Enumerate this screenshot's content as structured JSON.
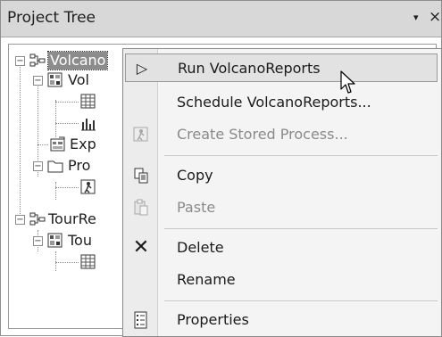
{
  "panel": {
    "title": "Project Tree",
    "pin_glyph": "▾",
    "close_glyph": "×"
  },
  "tree": {
    "nodes": [
      {
        "label": "VolcanoReports",
        "shown": "Volcano",
        "selected": true,
        "icon": "process-flow-icon"
      },
      {
        "label": "Vol",
        "icon": "program-icon"
      },
      {
        "label": "",
        "icon": "table-icon"
      },
      {
        "label": "",
        "icon": "chart-icon"
      },
      {
        "label": "Exp",
        "icon": "export-icon"
      },
      {
        "label": "Pro",
        "icon": "folder-icon"
      },
      {
        "label": "",
        "icon": "task-icon"
      },
      {
        "label": "TourRe",
        "icon": "process-flow-icon"
      },
      {
        "label": "Tou",
        "icon": "program-icon"
      },
      {
        "label": "",
        "icon": "table-icon"
      }
    ]
  },
  "context_menu": {
    "items": [
      {
        "label": "Run VolcanoReports",
        "icon": "run-icon",
        "glyph": "▷",
        "enabled": true,
        "highlighted": true
      },
      {
        "label": "Schedule VolcanoReports...",
        "icon": "",
        "glyph": "",
        "enabled": true
      },
      {
        "label": "Create Stored Process...",
        "icon": "stored-process-icon",
        "glyph": "",
        "enabled": false
      },
      {
        "label": "Copy",
        "icon": "copy-icon",
        "glyph": "",
        "enabled": true
      },
      {
        "label": "Paste",
        "icon": "paste-icon",
        "glyph": "",
        "enabled": false
      },
      {
        "label": "Delete",
        "icon": "delete-icon",
        "glyph": "✕",
        "enabled": true
      },
      {
        "label": "Rename",
        "icon": "",
        "glyph": "",
        "enabled": true
      },
      {
        "label": "Properties",
        "icon": "properties-icon",
        "glyph": "",
        "enabled": true
      }
    ]
  }
}
